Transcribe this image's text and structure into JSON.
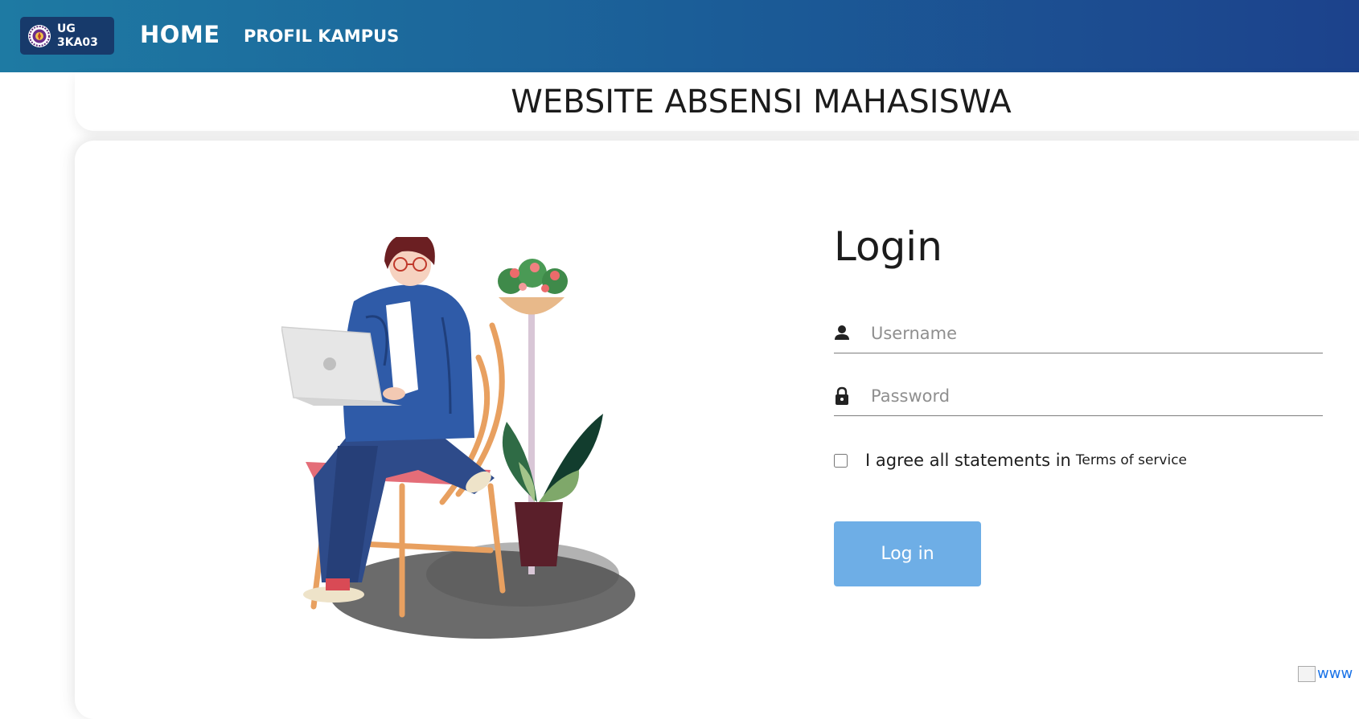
{
  "navbar": {
    "brand": {
      "logo_icon": "university-seal-icon",
      "line1": "UG",
      "line2": "3KA03"
    },
    "home_label": "HOME",
    "profil_label": "PROFIL KAMPUS",
    "gradient": [
      "#1e7aa3",
      "#1c428c"
    ]
  },
  "page_title": "WEBSITE ABSENSI MAHASISWA",
  "illustration": {
    "icon": "student-with-laptop-illustration"
  },
  "login": {
    "title": "Login",
    "username": {
      "icon": "person-icon",
      "placeholder": "Username",
      "value": ""
    },
    "password": {
      "icon": "lock-icon",
      "placeholder": "Password",
      "value": ""
    },
    "agree_text": "I agree all statements in",
    "terms_link": "Terms of service",
    "agree_checked": false,
    "button_label": "Log in",
    "button_color": "#6eaee6"
  },
  "footer_broken_image_text": "www"
}
